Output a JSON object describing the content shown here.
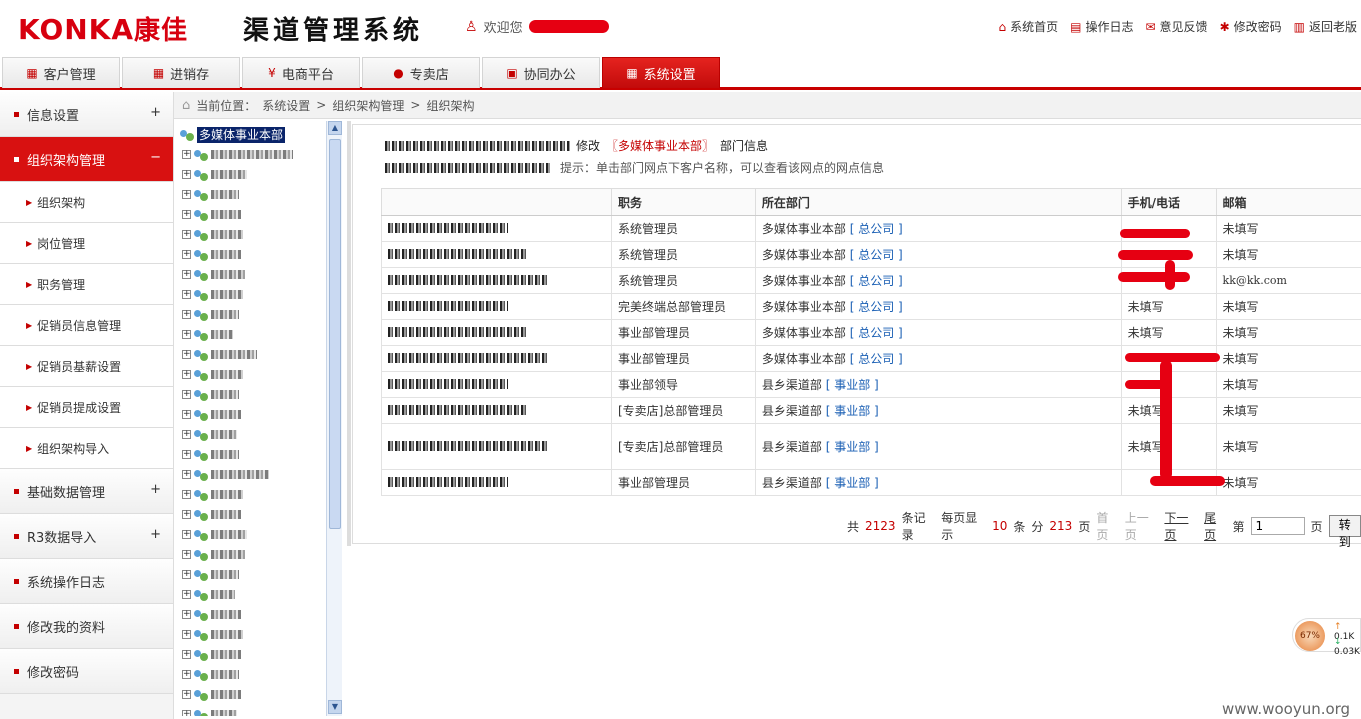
{
  "header": {
    "logo": "KONKA",
    "logo_cn": "康佳",
    "system_title": "渠道管理系统",
    "welcome": "欢迎您",
    "links": [
      {
        "label": "系统首页",
        "icon": "home-icon"
      },
      {
        "label": "操作日志",
        "icon": "log-icon"
      },
      {
        "label": "意见反馈",
        "icon": "mail-icon"
      },
      {
        "label": "修改密码",
        "icon": "gear-icon"
      },
      {
        "label": "返回老版",
        "icon": "back-icon"
      }
    ]
  },
  "tabs": [
    {
      "label": "客户管理",
      "icon": "customer-icon"
    },
    {
      "label": "进销存",
      "icon": "grid-icon"
    },
    {
      "label": "电商平台",
      "icon": "shop-icon"
    },
    {
      "label": "专卖店",
      "icon": "user-icon"
    },
    {
      "label": "协同办公",
      "icon": "office-icon"
    },
    {
      "label": "系统设置",
      "icon": "settings-icon",
      "active": true
    }
  ],
  "sidebar": {
    "items": [
      {
        "label": "信息设置",
        "toggle": "+"
      },
      {
        "label": "组织架构管理",
        "toggle": "−",
        "active": true
      },
      {
        "label": "组织架构",
        "sub": true
      },
      {
        "label": "岗位管理",
        "sub": true
      },
      {
        "label": "职务管理",
        "sub": true
      },
      {
        "label": "促销员信息管理",
        "sub": true
      },
      {
        "label": "促销员基薪设置",
        "sub": true
      },
      {
        "label": "促销员提成设置",
        "sub": true
      },
      {
        "label": "组织架构导入",
        "sub": true
      },
      {
        "label": "基础数据管理",
        "toggle": "+"
      },
      {
        "label": "R3数据导入",
        "toggle": "+"
      },
      {
        "label": "系统操作日志",
        "toggle": ""
      },
      {
        "label": "修改我的资料",
        "toggle": ""
      },
      {
        "label": "修改密码",
        "toggle": ""
      }
    ]
  },
  "breadcrumb": {
    "prefix": "当前位置：",
    "parts": [
      "系统设置",
      "组织架构管理",
      "组织架构"
    ],
    "sep": ">"
  },
  "tree": {
    "root": "多媒体事业本部"
  },
  "content": {
    "action": "修改",
    "dept": "〖多媒体事业本部〗",
    "suffix": "部门信息",
    "tip": "提示：单击部门网点下客户名称，可以查看该网点的网点信息",
    "columns": [
      "职务",
      "所在部门",
      "手机/电话",
      "邮箱"
    ],
    "rows": [
      {
        "role": "系统管理员",
        "dept": "多媒体事业本部",
        "link": "总公司",
        "phone": "",
        "email": "未填写"
      },
      {
        "role": "系统管理员",
        "dept": "多媒体事业本部",
        "link": "总公司",
        "phone": "",
        "email": "未填写"
      },
      {
        "role": "系统管理员",
        "dept": "多媒体事业本部",
        "link": "总公司",
        "phone": "",
        "email": "kk@kk.com"
      },
      {
        "role": "完美终端总部管理员",
        "dept": "多媒体事业本部",
        "link": "总公司",
        "phone": "未填写",
        "email": "未填写"
      },
      {
        "role": "事业部管理员",
        "dept": "多媒体事业本部",
        "link": "总公司",
        "phone": "未填写",
        "email": "未填写"
      },
      {
        "role": "事业部管理员",
        "dept": "多媒体事业本部",
        "link": "总公司",
        "phone": "",
        "email": "未填写"
      },
      {
        "role": "事业部领导",
        "dept": "县乡渠道部",
        "link": "事业部",
        "phone": "",
        "email": "未填写"
      },
      {
        "role": "[专卖店]总部管理员",
        "dept": "县乡渠道部",
        "link": "事业部",
        "phone": "未填写",
        "email": "未填写"
      },
      {
        "role": "[专卖店]总部管理员",
        "dept": "县乡渠道部",
        "link": "事业部",
        "phone": "未填写",
        "email": "未填写"
      },
      {
        "role": "事业部管理员",
        "dept": "县乡渠道部",
        "link": "事业部",
        "phone": "",
        "email": "未填写"
      }
    ]
  },
  "pager": {
    "total_prefix": "共",
    "total": "2123",
    "total_suffix": "条记录",
    "per_page_prefix": "每页显示",
    "per_page": "10",
    "per_page_suffix": "条",
    "pages_prefix": "分",
    "pages": "213",
    "pages_suffix": "页",
    "first": "首页",
    "prev": "上一页",
    "next": "下一页",
    "last": "尾页",
    "page_prefix": "第",
    "page_value": "1",
    "page_suffix": "页",
    "goto": "转到"
  },
  "network": {
    "percent": "67%",
    "up": "0.1K",
    "down": "0.03K"
  },
  "watermark": "www.wooyun.org"
}
